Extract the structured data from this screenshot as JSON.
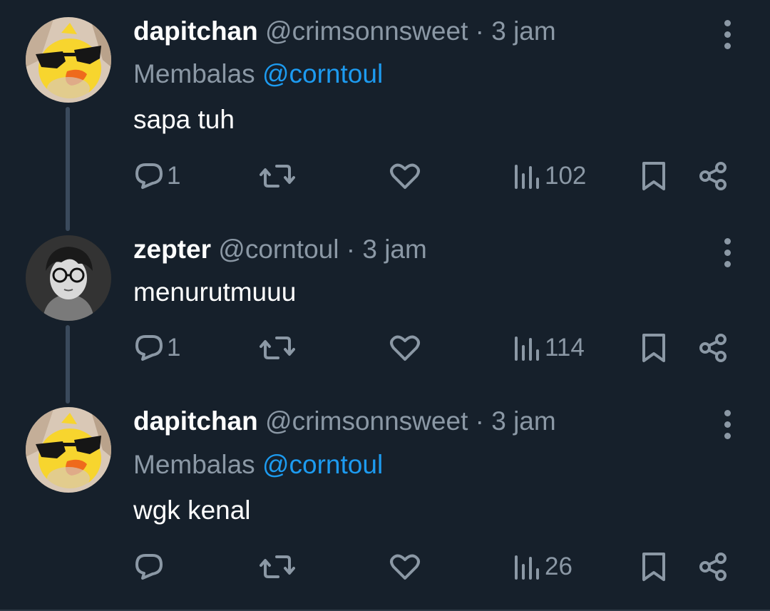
{
  "tweets": [
    {
      "name": "dapitchan",
      "handle": "@crimsonnsweet",
      "separator": "·",
      "time": "3 jam",
      "reply_prefix": "Membalas",
      "reply_to": "@corntoul",
      "text": "sapa tuh",
      "replies": "1",
      "views": "102",
      "avatar": "duck-with-sunglasses-avatar"
    },
    {
      "name": "zepter",
      "handle": "@corntoul",
      "separator": "·",
      "time": "3 jam",
      "text": "menurutmuuu",
      "replies": "1",
      "views": "114",
      "avatar": "glasses-boy-avatar"
    },
    {
      "name": "dapitchan",
      "handle": "@crimsonnsweet",
      "separator": "·",
      "time": "3 jam",
      "reply_prefix": "Membalas",
      "reply_to": "@corntoul",
      "text": "wgk kenal",
      "replies": "",
      "views": "26",
      "avatar": "duck-with-sunglasses-avatar"
    }
  ],
  "icons": {
    "reply": "reply-icon",
    "retweet": "retweet-icon",
    "like": "heart-icon",
    "views": "views-icon",
    "bookmark": "bookmark-icon",
    "share": "share-icon",
    "more": "more-vertical-icon"
  },
  "colors": {
    "background": "#16202b",
    "muted": "#8b98a5",
    "accent": "#1d9bf0",
    "thread_line": "#3a4a5c"
  }
}
